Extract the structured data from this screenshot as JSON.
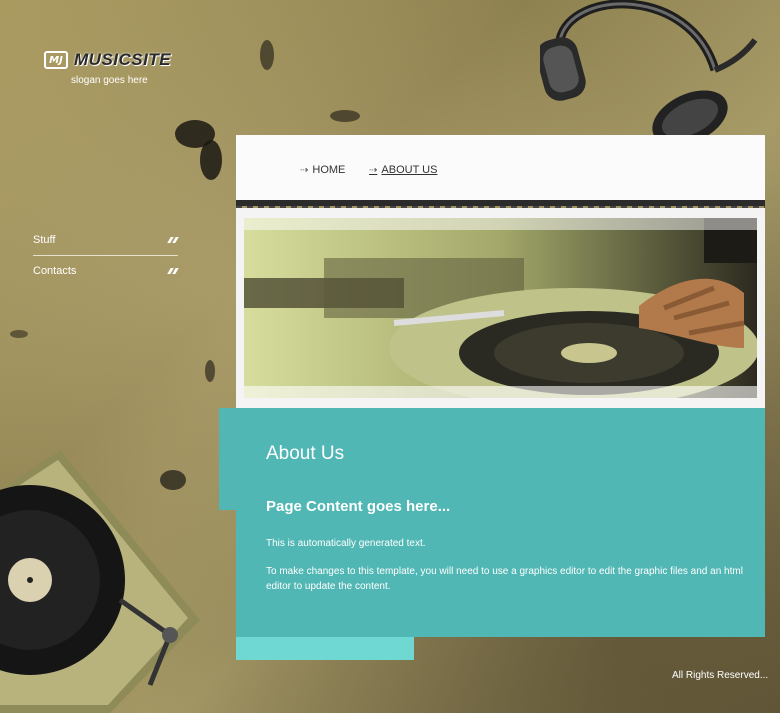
{
  "brand": {
    "logo_mark": "MJ",
    "name": "MUSICSITE",
    "slogan": "slogan goes here"
  },
  "side_nav": [
    {
      "label": "Stuff"
    },
    {
      "label": "Contacts"
    }
  ],
  "top_nav": {
    "home": "HOME",
    "about": "ABOUT US"
  },
  "content": {
    "heading": "About Us",
    "subheading": "Page Content goes here...",
    "paragraph1": "This is automatically generated text.",
    "paragraph2": "To make changes to this template, you will need to use a graphics editor to edit the graphic files and an html editor to update the content."
  },
  "footer": {
    "text": "All Rights Reserved..."
  },
  "colors": {
    "content_bg": "#51b7b4",
    "content_tear": "#6fd8d3",
    "background": "#9b8e5c"
  },
  "icons": {
    "nav_arrow": "arrow-right-icon",
    "side_arrow": "double-slash-icon"
  }
}
